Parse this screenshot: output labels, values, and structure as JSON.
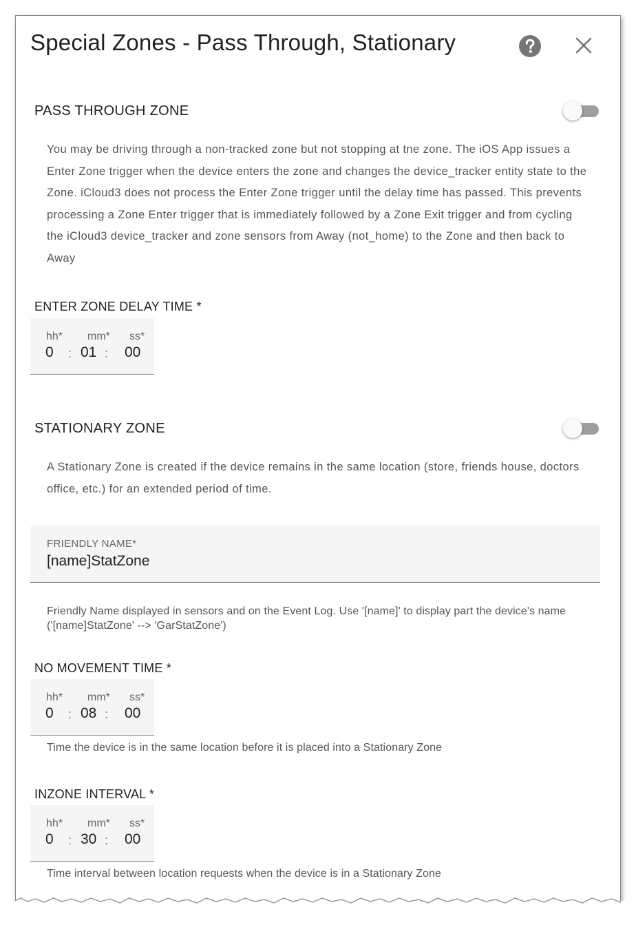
{
  "dialog": {
    "title": "Special Zones - Pass Through, Stationary",
    "help_icon": "help-circle-icon",
    "close_icon": "close-icon"
  },
  "pass_through": {
    "title": "PASS THROUGH ZONE",
    "toggle_on": false,
    "description": "You may be driving through a non-tracked zone but not stopping at tne zone. The iOS App issues a Enter Zone trigger when the device enters the zone and changes the device_tracker entity state to the Zone. iCloud3 does not process the Enter Zone trigger until the delay time has passed. This prevents processing a Zone Enter trigger that is immediately followed by a Zone Exit trigger and from cycling the iCloud3 device_tracker and zone sensors from Away (not_home) to the Zone and then back to Away",
    "delay_label": "ENTER ZONE DELAY TIME *",
    "delay": {
      "hh_label": "hh*",
      "mm_label": "mm*",
      "ss_label": "ss*",
      "hh": "0",
      "mm": "01",
      "ss": "00"
    }
  },
  "stationary": {
    "title": "STATIONARY ZONE",
    "toggle_on": false,
    "description": "A Stationary Zone is created if the device remains in the same location (store, friends house, doctors office, etc.) for an extended period of time.",
    "friendly_name": {
      "label": "FRIENDLY NAME*",
      "value": "[name]StatZone",
      "helper": "Friendly Name displayed in sensors and on the Event Log. Use '[name]' to display part the device's name ('[name]StatZone' --> 'GarStatZone')"
    },
    "no_movement": {
      "label": "NO MOVEMENT TIME *",
      "hh_label": "hh*",
      "mm_label": "mm*",
      "ss_label": "ss*",
      "hh": "0",
      "mm": "08",
      "ss": "00",
      "helper": "Time the device is in the same location before it is placed into a Stationary Zone"
    },
    "inzone_interval": {
      "label": "INZONE INTERVAL *",
      "hh_label": "hh*",
      "mm_label": "mm*",
      "ss_label": "ss*",
      "hh": "0",
      "mm": "30",
      "ss": "00",
      "helper": "Time interval between location requests when the device is in a Stationary Zone"
    }
  },
  "colors": {
    "toggle_track": "#9e9e9e",
    "field_background": "#f5f5f5",
    "icon": "#757575"
  }
}
